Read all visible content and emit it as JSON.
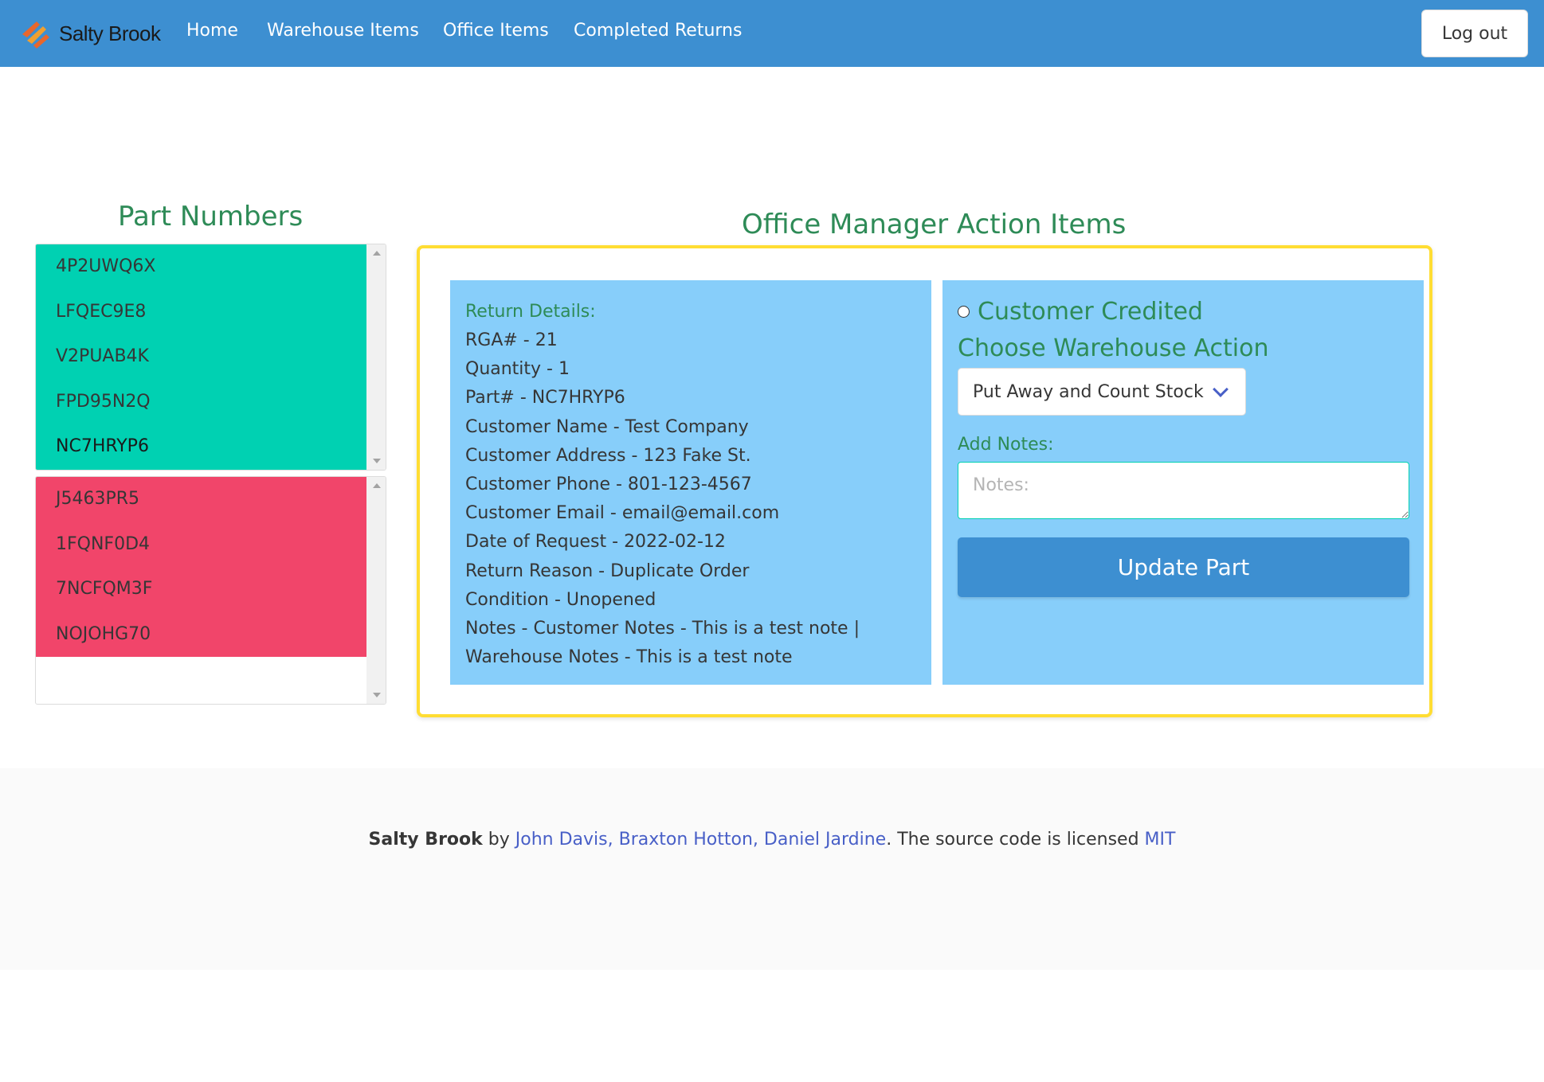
{
  "navbar": {
    "brand": "Salty Brook",
    "links": [
      "Home",
      "Warehouse Items",
      "Office Items",
      "Completed Returns"
    ],
    "logout": "Log out"
  },
  "part_numbers": {
    "title": "Part Numbers",
    "green_list": [
      "4P2UWQ6X",
      "LFQEC9E8",
      "V2PUAB4K",
      "FPD95N2Q",
      "NC7HRYP6"
    ],
    "red_list": [
      "J5463PR5",
      "1FQNF0D4",
      "7NCFQM3F",
      "NOJOHG70"
    ]
  },
  "action": {
    "title": "Office Manager Action Items",
    "details_label": "Return Details:",
    "details": [
      "RGA# - 21",
      "Quantity - 1",
      "Part# - NC7HRYP6",
      "Customer Name - Test Company",
      "Customer Address - 123 Fake St.",
      "Customer Phone - 801-123-4567",
      "Customer Email - email@email.com",
      "Date of Request - 2022-02-12",
      "Return Reason - Duplicate Order",
      "Condition - Unopened",
      "Notes - Customer Notes - This is a test note |",
      "Warehouse Notes - This is a test note"
    ],
    "customer_credited": "Customer Credited",
    "choose_action": "Choose Warehouse Action",
    "selected_action": "Put Away and Count Stock",
    "notes_label": "Add Notes:",
    "notes_placeholder": "Notes:",
    "update_button": "Update Part"
  },
  "footer": {
    "brand": "Salty Brook",
    "by": " by ",
    "authors": "John Davis, Braxton Hotton, Daniel Jardine",
    "license_text": ". The source code is licensed ",
    "license": "MIT"
  },
  "colors": {
    "navbar": "#3d8fd1",
    "green_list": "#00d1b2",
    "red_list": "#f1456a",
    "panel": "#87cefa",
    "accent_text": "#2e8b57",
    "border_yellow": "#ffdd33"
  }
}
